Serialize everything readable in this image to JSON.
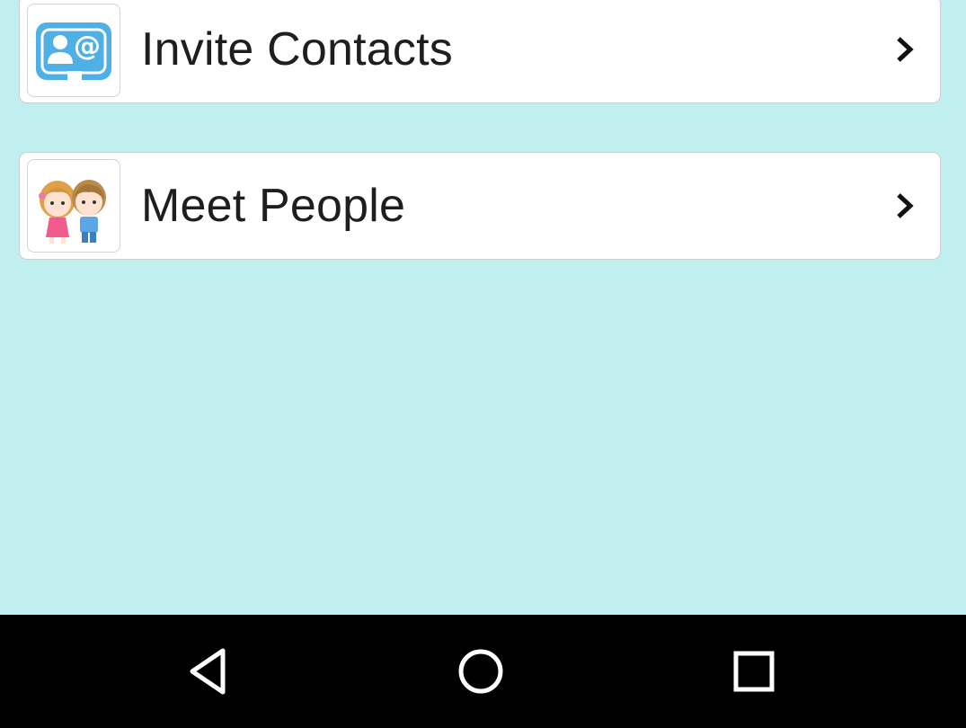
{
  "menu": {
    "items": [
      {
        "label": "Invite Contacts",
        "icon": "contact-card-icon"
      },
      {
        "label": "Meet People",
        "icon": "couple-avatar-icon"
      }
    ]
  },
  "navbar": {
    "buttons": [
      {
        "icon": "back-triangle-icon"
      },
      {
        "icon": "home-circle-icon"
      },
      {
        "icon": "recents-square-icon"
      }
    ]
  },
  "colors": {
    "background": "#c1efef",
    "card": "#ffffff",
    "contact_icon_blue": "#4fb0e6",
    "navbar": "#000000"
  }
}
